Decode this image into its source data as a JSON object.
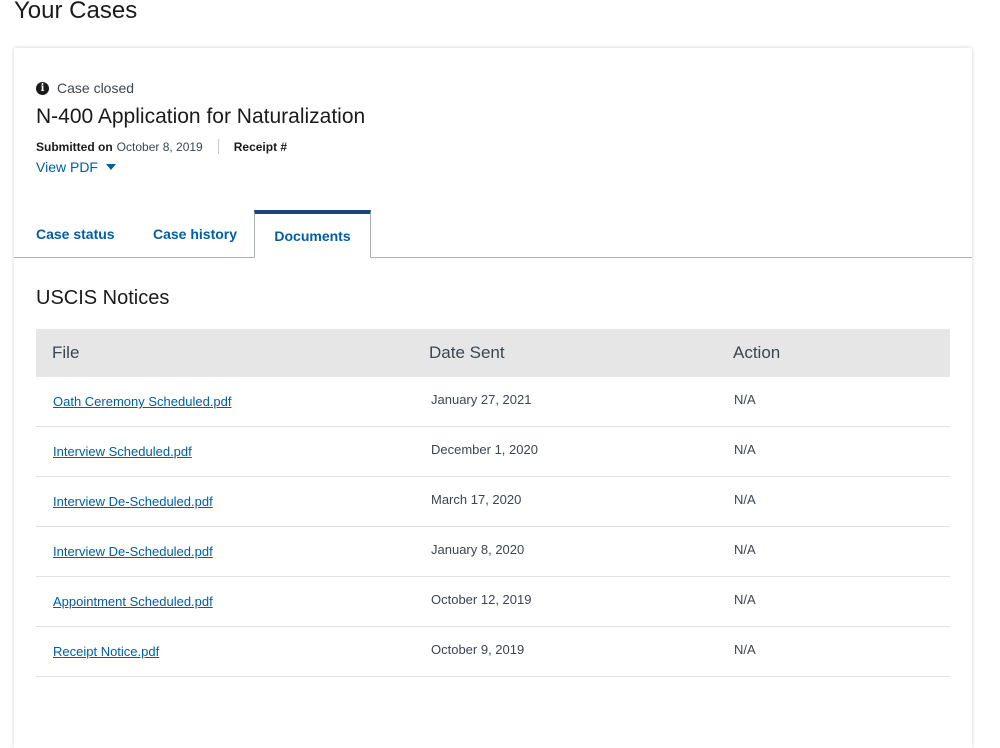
{
  "page": {
    "title": "Your Cases"
  },
  "case": {
    "status": "Case closed",
    "title": "N-400 Application for Naturalization",
    "submitted_label": "Submitted on",
    "submitted_date": "October 8, 2019",
    "receipt_label": "Receipt #",
    "view_pdf_label": "View PDF"
  },
  "tabs": [
    {
      "label": "Case status"
    },
    {
      "label": "Case history"
    },
    {
      "label": "Documents",
      "active": true
    }
  ],
  "notices": {
    "title": "USCIS Notices",
    "columns": [
      "File",
      "Date Sent",
      "Action"
    ],
    "rows": [
      {
        "file": "Oath Ceremony Scheduled.pdf",
        "date": "January 27, 2021",
        "action": "N/A"
      },
      {
        "file": "Interview Scheduled.pdf",
        "date": "December 1, 2020",
        "action": "N/A"
      },
      {
        "file": "Interview De-Scheduled.pdf",
        "date": "March 17, 2020",
        "action": "N/A"
      },
      {
        "file": "Interview De-Scheduled.pdf",
        "date": "January 8, 2020",
        "action": "N/A"
      },
      {
        "file": "Appointment Scheduled.pdf",
        "date": "October 12, 2019",
        "action": "N/A"
      },
      {
        "file": "Receipt Notice.pdf",
        "date": "October 9, 2019",
        "action": "N/A"
      }
    ]
  },
  "icons": {
    "status": "info-icon",
    "dropdown": "caret-down-icon"
  },
  "colors": {
    "link": "#005ea2",
    "active_tab_border": "#1a4480",
    "header_bg": "#e6e6e6"
  }
}
